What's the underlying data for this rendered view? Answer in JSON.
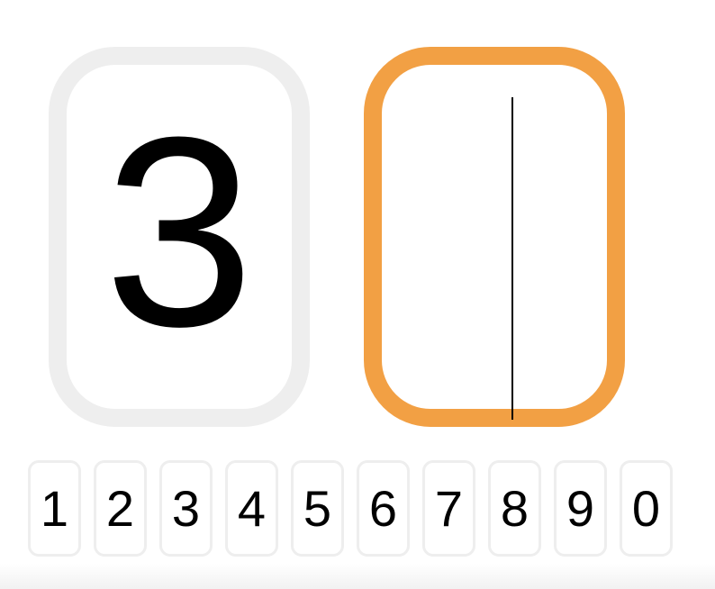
{
  "code": {
    "digits": [
      "3",
      ""
    ],
    "active_index": 1
  },
  "keypad": {
    "keys": [
      "1",
      "2",
      "3",
      "4",
      "5",
      "6",
      "7",
      "8",
      "9",
      "0"
    ]
  },
  "colors": {
    "active_border": "#f2a044",
    "inactive_border": "#eeeeee",
    "key_border": "#eeeeee",
    "text": "#000000"
  }
}
